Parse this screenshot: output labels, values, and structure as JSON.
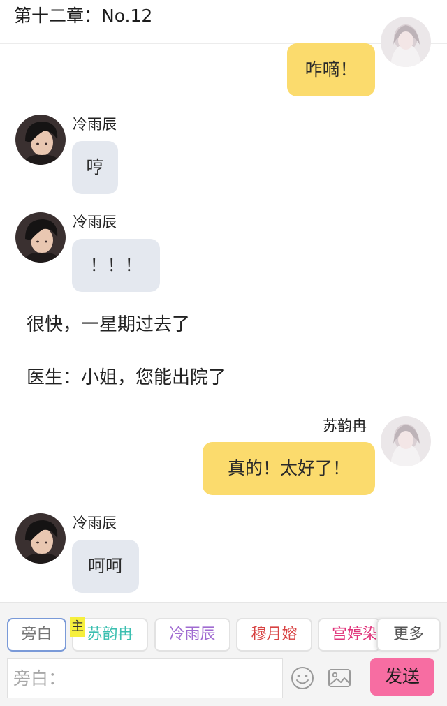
{
  "header": {
    "title": "第十二章：No.12"
  },
  "messages": [
    {
      "side": "right",
      "name": "",
      "text": "咋嘀！"
    },
    {
      "side": "left",
      "name": "冷雨辰",
      "text": "哼"
    },
    {
      "side": "left",
      "name": "冷雨辰",
      "text": "！！！"
    },
    {
      "type": "narration",
      "text": "很快，一星期过去了"
    },
    {
      "type": "narration",
      "text": "医生：小姐，您能出院了"
    },
    {
      "side": "right",
      "name": "苏韵冉",
      "text": "真的！太好了！"
    },
    {
      "side": "left",
      "name": "冷雨辰",
      "text": "呵呵"
    }
  ],
  "toolbar": {
    "badge": "主",
    "characters": [
      {
        "label": "旁白",
        "color": "#777777"
      },
      {
        "label": "苏韵冉",
        "color": "#3bbfb0"
      },
      {
        "label": "冷雨辰",
        "color": "#a06bd1"
      },
      {
        "label": "穆月嫆",
        "color": "#d84343"
      },
      {
        "label": "宫婷染",
        "color": "#e0337a"
      }
    ],
    "more_label": "更多"
  },
  "composer": {
    "placeholder": "旁白：",
    "send_label": "发送",
    "send_color": "#f76da2"
  },
  "icons": [
    "emoji-icon",
    "image-icon"
  ]
}
